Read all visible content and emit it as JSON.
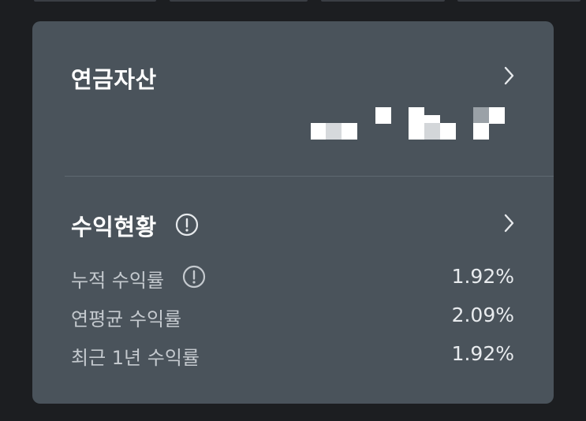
{
  "pension_assets": {
    "title": "연금자산",
    "chevron_icon": "chevron-right-icon",
    "value_masked": true
  },
  "returns": {
    "title": "수익현황",
    "info_icon": "info-circle-icon",
    "chevron_icon": "chevron-right-icon",
    "metrics": [
      {
        "label": "누적 수익률",
        "value": "1.92%",
        "has_info": true
      },
      {
        "label": "연평균 수익률",
        "value": "2.09%",
        "has_info": false
      },
      {
        "label": "최근 1년 수익률",
        "value": "1.92%",
        "has_info": false
      }
    ]
  },
  "colors": {
    "card_bg": "#4a535b",
    "page_bg": "#1c1e21",
    "title_text": "#ffffff",
    "label_text": "#c4c9ce",
    "value_text": "#e8ebee"
  }
}
